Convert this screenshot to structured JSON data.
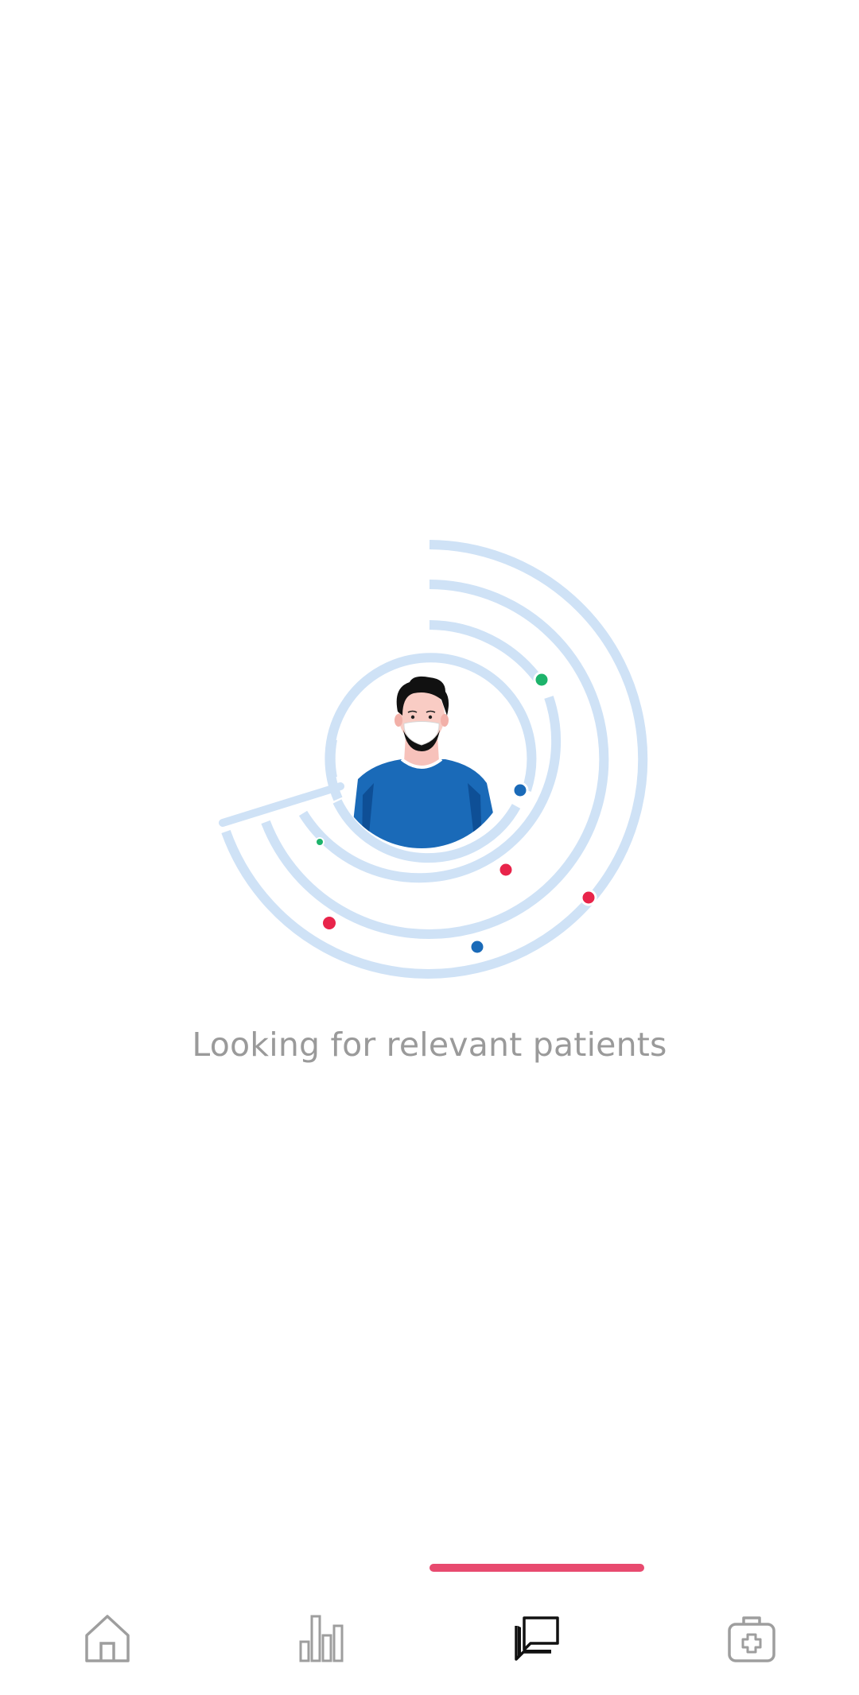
{
  "status": {
    "message": "Looking for relevant patients"
  },
  "colors": {
    "ring": "#cfe2f6",
    "accent_pink": "#e84a6f",
    "dot_green": "#1db36b",
    "dot_blue": "#1a6ab8",
    "dot_red": "#e8244a",
    "text_gray": "#9a9a9a",
    "icon_gray": "#9e9e9e",
    "icon_active": "#111111"
  },
  "bottom_nav": {
    "active_index": 2,
    "items": [
      {
        "icon": "home-icon"
      },
      {
        "icon": "bar-chart-icon"
      },
      {
        "icon": "chat-bubbles-icon"
      },
      {
        "icon": "medical-kit-icon"
      }
    ]
  }
}
